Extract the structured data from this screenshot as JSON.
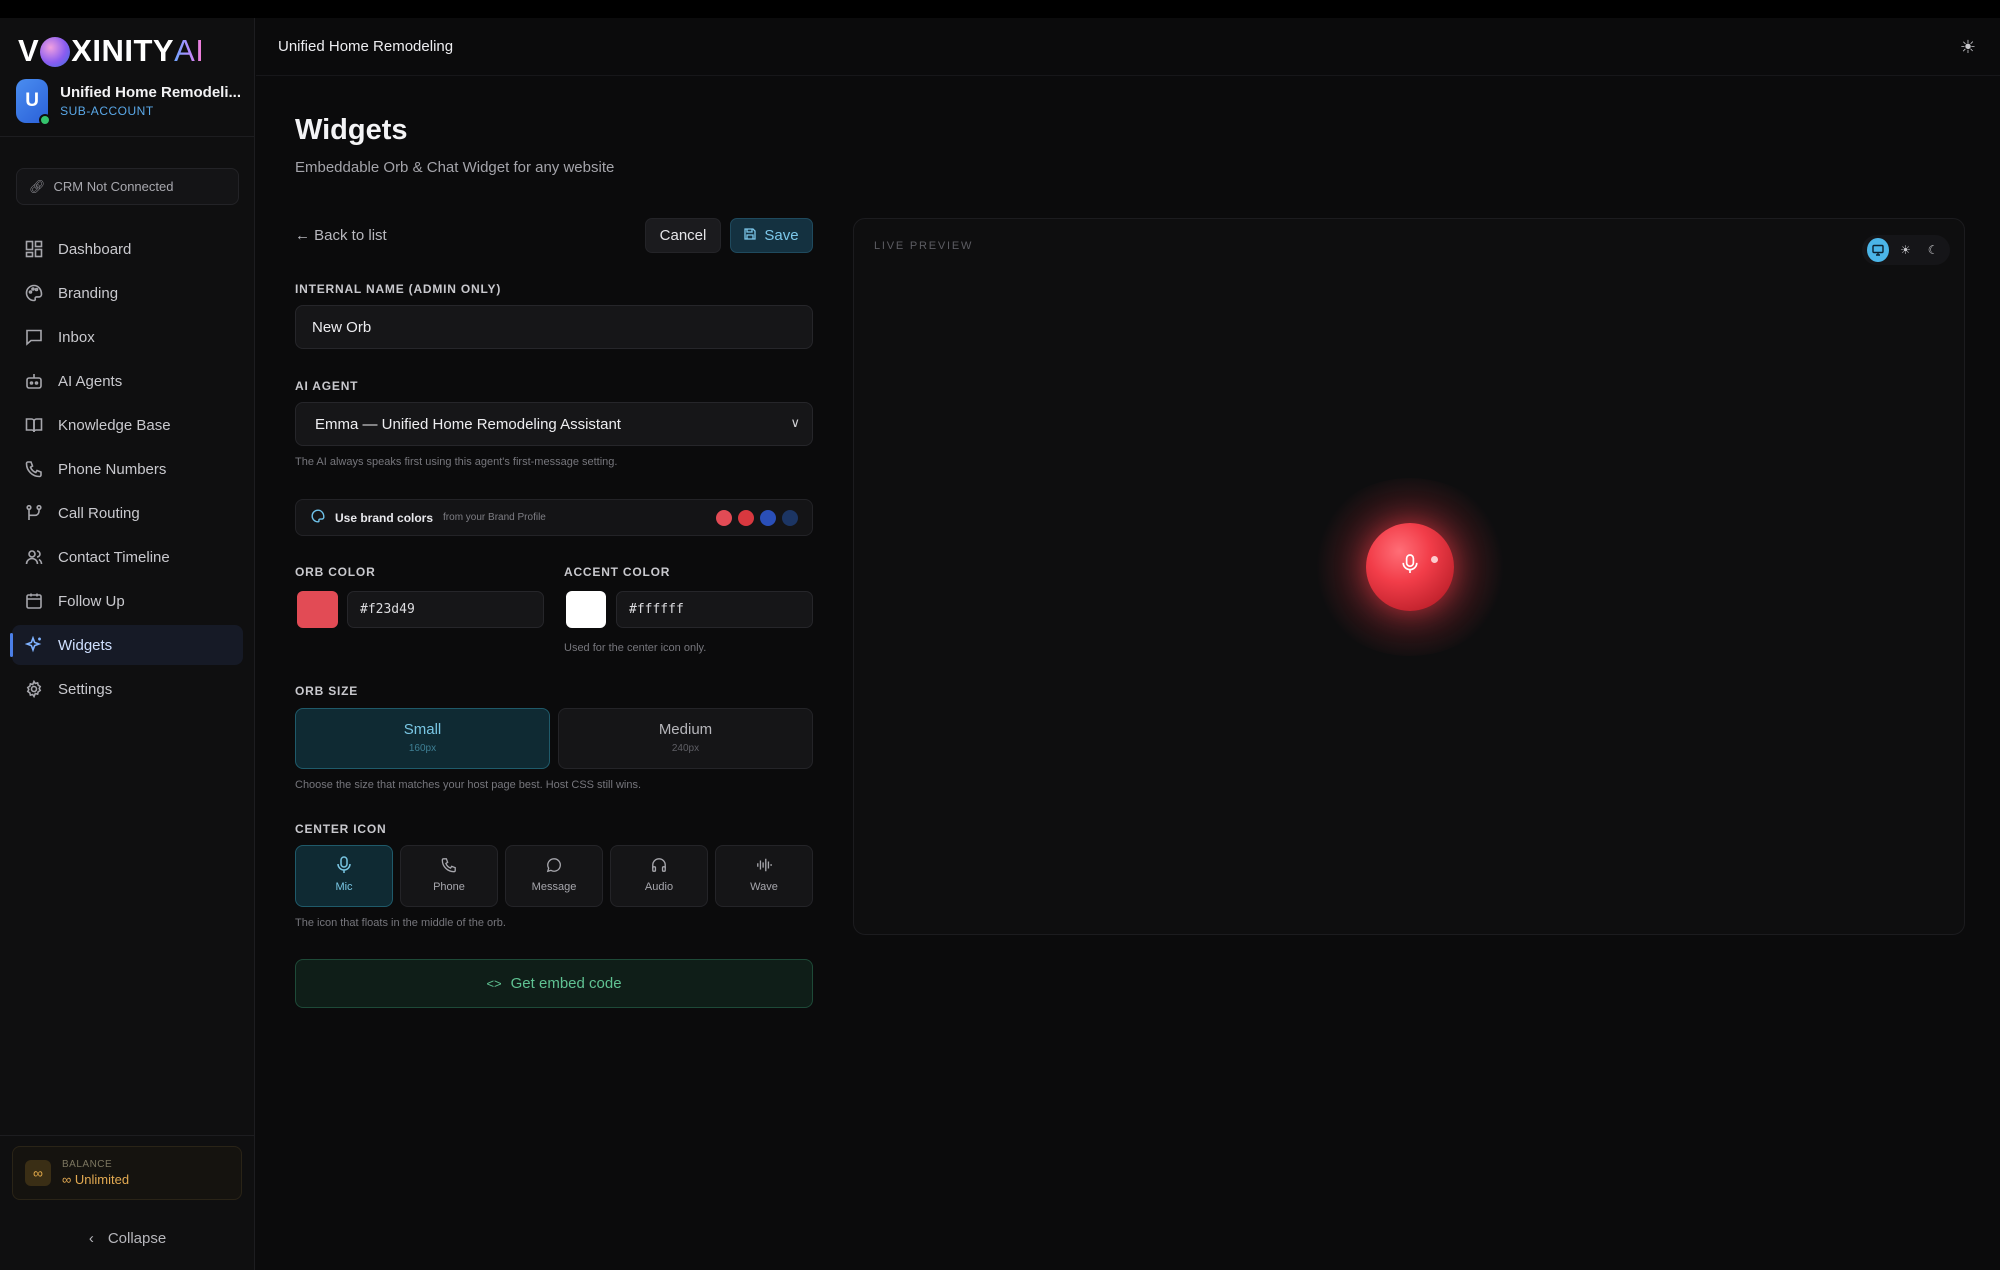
{
  "app": {
    "logo_text_left": "V",
    "logo_text_mid": "XINITY",
    "logo_text_ai": "AI"
  },
  "account": {
    "avatar_letter": "U",
    "name": "Unified Home Remodeli...",
    "type": "SUB-ACCOUNT"
  },
  "crm": {
    "status": "CRM Not Connected",
    "icon": "link-icon"
  },
  "sidebar": {
    "items": [
      {
        "label": "Dashboard",
        "icon": "dashboard-icon"
      },
      {
        "label": "Branding",
        "icon": "palette-icon"
      },
      {
        "label": "Inbox",
        "icon": "chat-icon"
      },
      {
        "label": "AI Agents",
        "icon": "robot-icon"
      },
      {
        "label": "Knowledge Base",
        "icon": "book-icon"
      },
      {
        "label": "Phone Numbers",
        "icon": "phone-icon"
      },
      {
        "label": "Call Routing",
        "icon": "routing-icon"
      },
      {
        "label": "Contact Timeline",
        "icon": "contacts-icon"
      },
      {
        "label": "Follow Up",
        "icon": "calendar-icon"
      },
      {
        "label": "Widgets",
        "icon": "sparkle-icon",
        "active": true
      },
      {
        "label": "Settings",
        "icon": "gear-icon"
      }
    ],
    "balance_label": "BALANCE",
    "balance_value": "Unlimited",
    "collapse_label": "Collapse"
  },
  "header": {
    "title": "Unified Home Remodeling"
  },
  "page": {
    "title": "Widgets",
    "subtitle": "Embeddable Orb & Chat Widget for any website"
  },
  "editor": {
    "back_label": "Back to list",
    "cancel_label": "Cancel",
    "save_label": "Save",
    "internal_name_label": "INTERNAL NAME (ADMIN ONLY)",
    "internal_name_value": "New Orb",
    "agent_label": "AI AGENT",
    "agent_value": "Emma — Unified Home Remodeling Assistant",
    "agent_hint": "The AI always speaks first using this agent's first-message setting.",
    "brand_label": "Use brand colors",
    "brand_sub": "from your Brand Profile",
    "brand_swatches": [
      "#e24b55",
      "#d8383f",
      "#2a4fb8",
      "#1c3563"
    ],
    "orb_color_label": "ORB COLOR",
    "orb_color_value": "#f23d49",
    "accent_color_label": "ACCENT COLOR",
    "accent_color_value": "#ffffff",
    "accent_hint": "Used for the center icon only.",
    "orb_size_label": "ORB SIZE",
    "sizes": [
      {
        "name": "Small",
        "px": "160px",
        "selected": true
      },
      {
        "name": "Medium",
        "px": "240px",
        "selected": false
      }
    ],
    "size_hint": "Choose the size that matches your host page best. Host CSS still wins.",
    "center_icon_label": "CENTER ICON",
    "icons": [
      {
        "name": "Mic",
        "icon": "mic-icon",
        "selected": true
      },
      {
        "name": "Phone",
        "icon": "phone-icon",
        "selected": false
      },
      {
        "name": "Message",
        "icon": "message-icon",
        "selected": false
      },
      {
        "name": "Audio",
        "icon": "headphones-icon",
        "selected": false
      },
      {
        "name": "Wave",
        "icon": "wave-icon",
        "selected": false
      }
    ],
    "icon_hint": "The icon that floats in the middle of the orb.",
    "embed_label": "Get embed code"
  },
  "preview": {
    "label": "LIVE PREVIEW",
    "modes": [
      "desktop-icon",
      "sun-icon",
      "moon-icon"
    ],
    "active_mode": "desktop-icon"
  }
}
